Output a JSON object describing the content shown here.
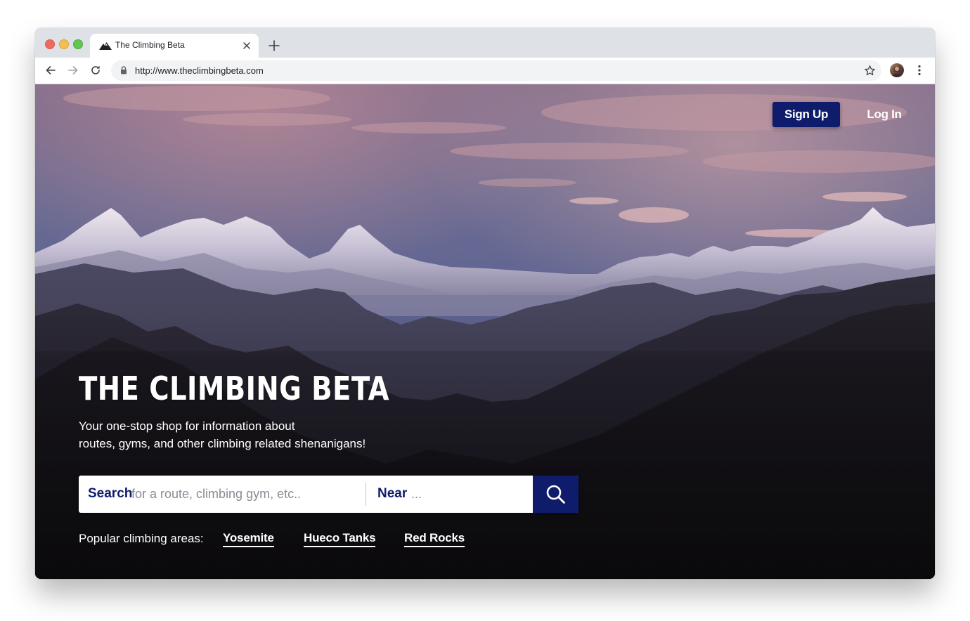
{
  "browser": {
    "tab_title": "The Climbing Beta",
    "url": "http://www.theclimbingbeta.com",
    "icons": {
      "favicon": "mountain-icon",
      "tab_close": "close-icon",
      "new_tab": "plus-icon",
      "back": "arrow-left-icon",
      "forward": "arrow-right-icon",
      "reload": "reload-icon",
      "lock": "lock-icon",
      "bookmark": "star-icon",
      "profile": "avatar",
      "menu": "kebab-menu-icon"
    }
  },
  "header": {
    "signup_label": "Sign Up",
    "login_label": "Log In"
  },
  "hero": {
    "title": "THE CLIMBING BETA",
    "tagline_line1": "Your one-stop shop for information about",
    "tagline_line2": "routes, gyms, and other climbing related shenanigans!"
  },
  "search": {
    "label": "Search",
    "placeholder": "for a route, climbing gym, etc..",
    "near_label": "Near",
    "near_placeholder": "...",
    "button_icon": "search-icon"
  },
  "popular": {
    "label": "Popular climbing areas:",
    "areas": [
      "Yosemite",
      "Hueco Tanks",
      "Red Rocks"
    ]
  },
  "colors": {
    "brand_navy": "#0f1c6b",
    "text_white": "#ffffff",
    "hint_gray": "#888c94",
    "chrome_frame": "#dee1e6"
  }
}
